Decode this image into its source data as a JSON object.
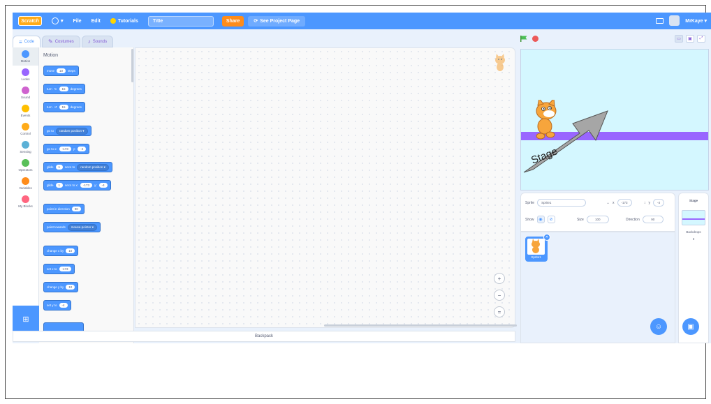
{
  "menubar": {
    "logo_text": "Scratch",
    "language_caret": "▾",
    "file_label": "File",
    "edit_label": "Edit",
    "tutorials_label": "Tutorials",
    "title_value": "Title",
    "share_label": "Share",
    "project_page_label": "See Project Page",
    "username": "MrKaye ▾",
    "accent_color": "#4c97ff"
  },
  "tabs": {
    "code": "Code",
    "costumes": "Costumes",
    "sounds": "Sounds"
  },
  "categories": [
    {
      "label": "Motion",
      "color": "#4c97ff"
    },
    {
      "label": "Looks",
      "color": "#9966ff"
    },
    {
      "label": "Sound",
      "color": "#cf63cf"
    },
    {
      "label": "Events",
      "color": "#ffbf00"
    },
    {
      "label": "Control",
      "color": "#ffab19"
    },
    {
      "label": "Sensing",
      "color": "#5cb1d6"
    },
    {
      "label": "Operators",
      "color": "#59c059"
    },
    {
      "label": "Variables",
      "color": "#ff8c1a"
    },
    {
      "label": "My Blocks",
      "color": "#ff6680"
    }
  ],
  "palette": {
    "title": "Motion",
    "blocks": {
      "move_pre": "move",
      "move_val": "10",
      "move_post": "steps",
      "turn_r_pre": "turn",
      "turn_r_val": "15",
      "turn_r_post": "degrees",
      "turn_l_pre": "turn",
      "turn_l_val": "15",
      "turn_l_post": "degrees",
      "goto_pre": "go to",
      "goto_dd": "random position ▾",
      "gotoxy_pre": "go to x:",
      "gotoxy_x": "-173",
      "gotoxy_mid": "y:",
      "gotoxy_y": "-4",
      "glide_pre": "glide",
      "glide_val": "1",
      "glide_mid": "secs to",
      "glide_dd": "random position ▾",
      "glidexy_pre": "glide",
      "glidexy_val": "1",
      "glidexy_mid": "secs to x:",
      "glidexy_x": "-173",
      "glidexy_ymid": "y:",
      "glidexy_y": "-4",
      "point_pre": "point in direction",
      "point_val": "90",
      "towards_pre": "point towards",
      "towards_dd": "mouse-pointer ▾",
      "changex_pre": "change x by",
      "changex_val": "10",
      "setx_pre": "set x to",
      "setx_val": "-173",
      "changey_pre": "change y by",
      "changey_val": "10",
      "sety_pre": "set y to",
      "sety_val": "-4"
    }
  },
  "code_area": {
    "zoom_in": "+",
    "zoom_out": "−",
    "zoom_reset": "="
  },
  "backpack_label": "Backpack",
  "stage": {
    "arrow_label": "Stage",
    "backdrop_color": "#d4f7ff",
    "bar_color": "#9966ff"
  },
  "sprite_info": {
    "sprite_label": "Sprite",
    "sprite_name": "Sprite1",
    "x_label": "x",
    "x_value": "-173",
    "y_label": "y",
    "y_value": "-4",
    "show_label": "Show",
    "size_label": "Size",
    "size_value": "100",
    "direction_label": "Direction",
    "direction_value": "90"
  },
  "sprite_list": [
    {
      "name": "Sprite1"
    }
  ],
  "stage_target": {
    "header": "Stage",
    "backdrops_label": "Backdrops",
    "backdrops_count": "3"
  }
}
